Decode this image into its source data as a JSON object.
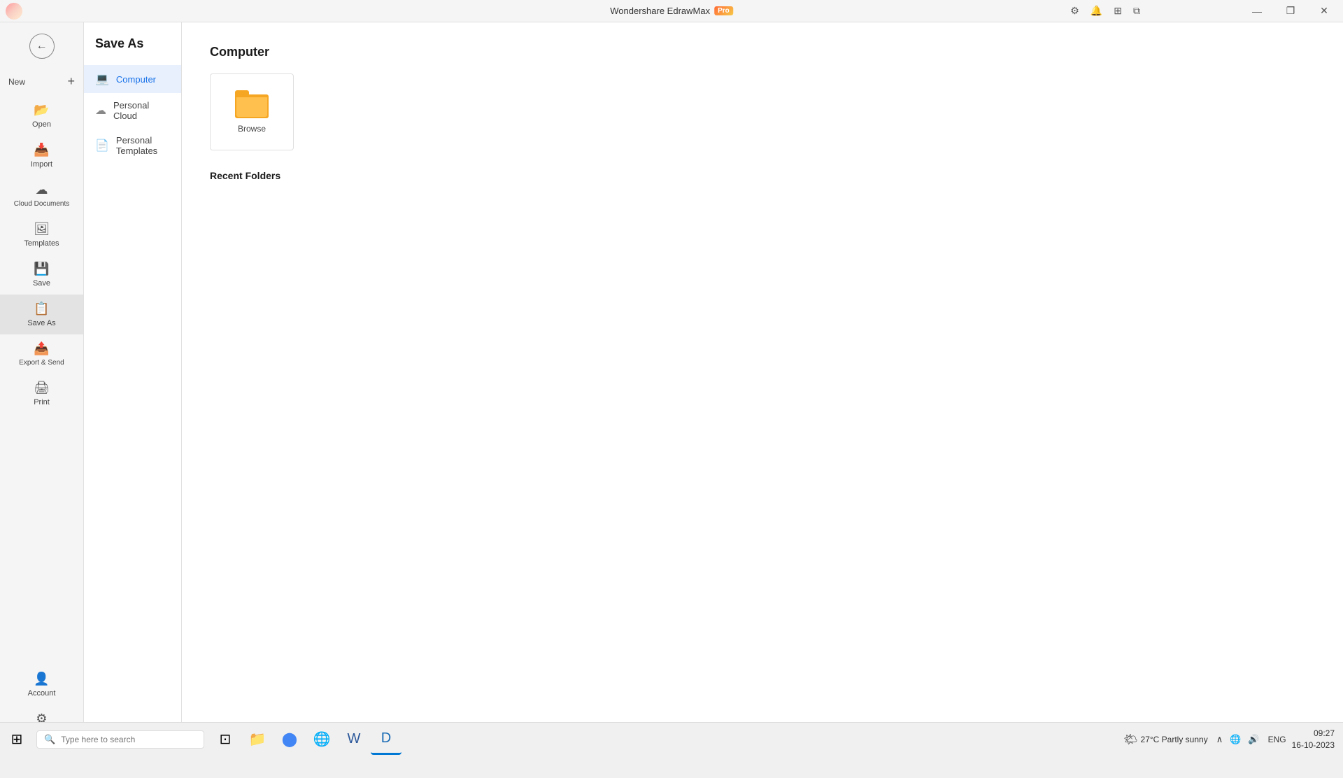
{
  "titlebar": {
    "app_name": "Wondershare EdrawMax",
    "pro_label": "Pro",
    "btn_minimize": "—",
    "btn_restore": "❐",
    "btn_close": "✕"
  },
  "left_sidebar": {
    "back_label": "←",
    "new_label": "New",
    "open_label": "Open",
    "import_label": "Import",
    "cloud_docs_label": "Cloud Documents",
    "templates_label": "Templates",
    "save_label": "Save",
    "save_as_label": "Save As",
    "export_label": "Export & Send",
    "print_label": "Print",
    "account_label": "Account",
    "options_label": "Options"
  },
  "middle_sidebar": {
    "title": "Save As",
    "items": [
      {
        "id": "computer",
        "label": "Computer",
        "icon": "💻",
        "active": true
      },
      {
        "id": "personal-cloud",
        "label": "Personal Cloud",
        "icon": "☁"
      },
      {
        "id": "personal-templates",
        "label": "Personal Templates",
        "icon": "📄"
      }
    ]
  },
  "content": {
    "section_title": "Computer",
    "browse_label": "Browse",
    "recent_folders_title": "Recent Folders"
  },
  "taskbar": {
    "search_placeholder": "Type here to search",
    "weather": "27°C  Partly sunny",
    "language": "ENG",
    "time": "09:27",
    "date": "16-10-2023"
  }
}
